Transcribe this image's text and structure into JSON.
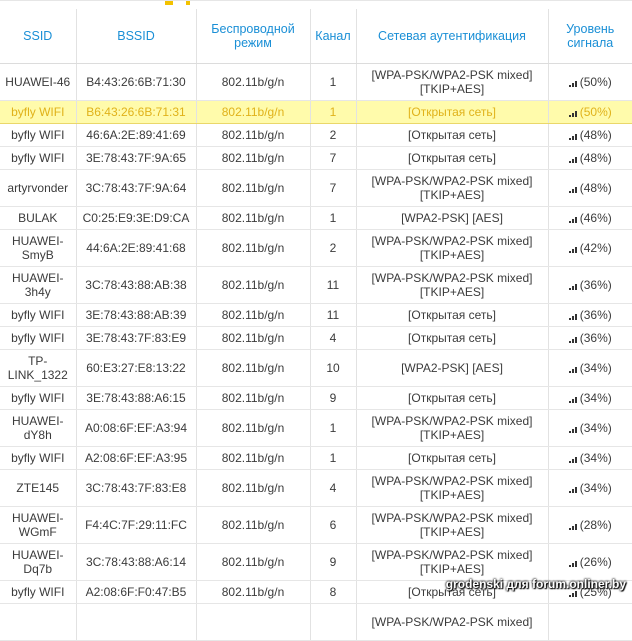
{
  "headers": {
    "ssid": "SSID",
    "bssid": "BSSID",
    "mode": "Беспроводной режим",
    "channel": "Канал",
    "auth": "Сетевая аутентификация",
    "signal": "Уровень сигнала"
  },
  "rows": [
    {
      "ssid": "HUAWEI-46",
      "bssid": "B4:43:26:6B:71:30",
      "mode": "802.11b/g/n",
      "channel": "1",
      "auth": "[WPA-PSK/WPA2-PSK mixed] [TKIP+AES]",
      "signal": "(50%)",
      "selected": false
    },
    {
      "ssid": "byfly WIFI",
      "bssid": "B6:43:26:6B:71:31",
      "mode": "802.11b/g/n",
      "channel": "1",
      "auth": "[Открытая сеть]",
      "signal": "(50%)",
      "selected": true
    },
    {
      "ssid": "byfly WIFI",
      "bssid": "46:6A:2E:89:41:69",
      "mode": "802.11b/g/n",
      "channel": "2",
      "auth": "[Открытая сеть]",
      "signal": "(48%)",
      "selected": false
    },
    {
      "ssid": "byfly WIFI",
      "bssid": "3E:78:43:7F:9A:65",
      "mode": "802.11b/g/n",
      "channel": "7",
      "auth": "[Открытая сеть]",
      "signal": "(48%)",
      "selected": false
    },
    {
      "ssid": "artyrvonder",
      "bssid": "3C:78:43:7F:9A:64",
      "mode": "802.11b/g/n",
      "channel": "7",
      "auth": "[WPA-PSK/WPA2-PSK mixed] [TKIP+AES]",
      "signal": "(48%)",
      "selected": false
    },
    {
      "ssid": "BULAK",
      "bssid": "C0:25:E9:3E:D9:CA",
      "mode": "802.11b/g/n",
      "channel": "1",
      "auth": "[WPA2-PSK] [AES]",
      "signal": "(46%)",
      "selected": false
    },
    {
      "ssid": "HUAWEI-SmyB",
      "bssid": "44:6A:2E:89:41:68",
      "mode": "802.11b/g/n",
      "channel": "2",
      "auth": "[WPA-PSK/WPA2-PSK mixed] [TKIP+AES]",
      "signal": "(42%)",
      "selected": false
    },
    {
      "ssid": "HUAWEI-3h4y",
      "bssid": "3C:78:43:88:AB:38",
      "mode": "802.11b/g/n",
      "channel": "11",
      "auth": "[WPA-PSK/WPA2-PSK mixed] [TKIP+AES]",
      "signal": "(36%)",
      "selected": false
    },
    {
      "ssid": "byfly WIFI",
      "bssid": "3E:78:43:88:AB:39",
      "mode": "802.11b/g/n",
      "channel": "11",
      "auth": "[Открытая сеть]",
      "signal": "(36%)",
      "selected": false
    },
    {
      "ssid": "byfly WIFI",
      "bssid": "3E:78:43:7F:83:E9",
      "mode": "802.11b/g/n",
      "channel": "4",
      "auth": "[Открытая сеть]",
      "signal": "(36%)",
      "selected": false
    },
    {
      "ssid": "TP-LINK_1322",
      "bssid": "60:E3:27:E8:13:22",
      "mode": "802.11b/g/n",
      "channel": "10",
      "auth": "[WPA2-PSK] [AES]",
      "signal": "(34%)",
      "selected": false
    },
    {
      "ssid": "byfly WIFI",
      "bssid": "3E:78:43:88:A6:15",
      "mode": "802.11b/g/n",
      "channel": "9",
      "auth": "[Открытая сеть]",
      "signal": "(34%)",
      "selected": false
    },
    {
      "ssid": "HUAWEI-dY8h",
      "bssid": "A0:08:6F:EF:A3:94",
      "mode": "802.11b/g/n",
      "channel": "1",
      "auth": "[WPA-PSK/WPA2-PSK mixed] [TKIP+AES]",
      "signal": "(34%)",
      "selected": false
    },
    {
      "ssid": "byfly WIFI",
      "bssid": "A2:08:6F:EF:A3:95",
      "mode": "802.11b/g/n",
      "channel": "1",
      "auth": "[Открытая сеть]",
      "signal": "(34%)",
      "selected": false
    },
    {
      "ssid": "ZTE145",
      "bssid": "3C:78:43:7F:83:E8",
      "mode": "802.11b/g/n",
      "channel": "4",
      "auth": "[WPA-PSK/WPA2-PSK mixed] [TKIP+AES]",
      "signal": "(34%)",
      "selected": false
    },
    {
      "ssid": "HUAWEI-WGmF",
      "bssid": "F4:4C:7F:29:11:FC",
      "mode": "802.11b/g/n",
      "channel": "6",
      "auth": "[WPA-PSK/WPA2-PSK mixed] [TKIP+AES]",
      "signal": "(28%)",
      "selected": false
    },
    {
      "ssid": "HUAWEI-Dq7b",
      "bssid": "3C:78:43:88:A6:14",
      "mode": "802.11b/g/n",
      "channel": "9",
      "auth": "[WPA-PSK/WPA2-PSK mixed] [TKIP+AES]",
      "signal": "(26%)",
      "selected": false
    },
    {
      "ssid": "byfly WIFI",
      "bssid": "A2:08:6F:F0:47:B5",
      "mode": "802.11b/g/n",
      "channel": "8",
      "auth": "[Открытая сеть]",
      "signal": "(25%)",
      "selected": false
    },
    {
      "ssid": "",
      "bssid": "",
      "mode": "",
      "channel": "",
      "auth": "[WPA-PSK/WPA2-PSK mixed]",
      "signal": "",
      "selected": false
    }
  ],
  "watermark": "grodenski для forum.onliner.by",
  "colors": {
    "header_text": "#1a8fd6",
    "selected_row_bg": "#fffbab",
    "selected_row_text": "#e0b21a"
  },
  "icons": {
    "signal": "signal-bars-icon"
  }
}
